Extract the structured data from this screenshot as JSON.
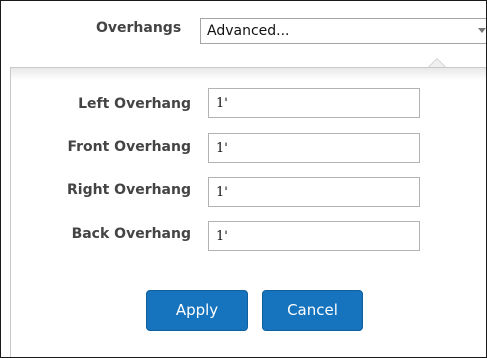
{
  "overhangs": {
    "label": "Overhangs",
    "selected_value": "Advanced...",
    "arrow_icon": "triangle-down-icon"
  },
  "fields": [
    {
      "label": "Left Overhang",
      "value": "1'"
    },
    {
      "label": "Front Overhang",
      "value": "1'"
    },
    {
      "label": "Right Overhang",
      "value": "1'"
    },
    {
      "label": "Back Overhang",
      "value": "1'"
    }
  ],
  "buttons": {
    "apply": "Apply",
    "cancel": "Cancel"
  },
  "colors": {
    "button_blue": "#1673bd",
    "label_gray": "#444444"
  }
}
